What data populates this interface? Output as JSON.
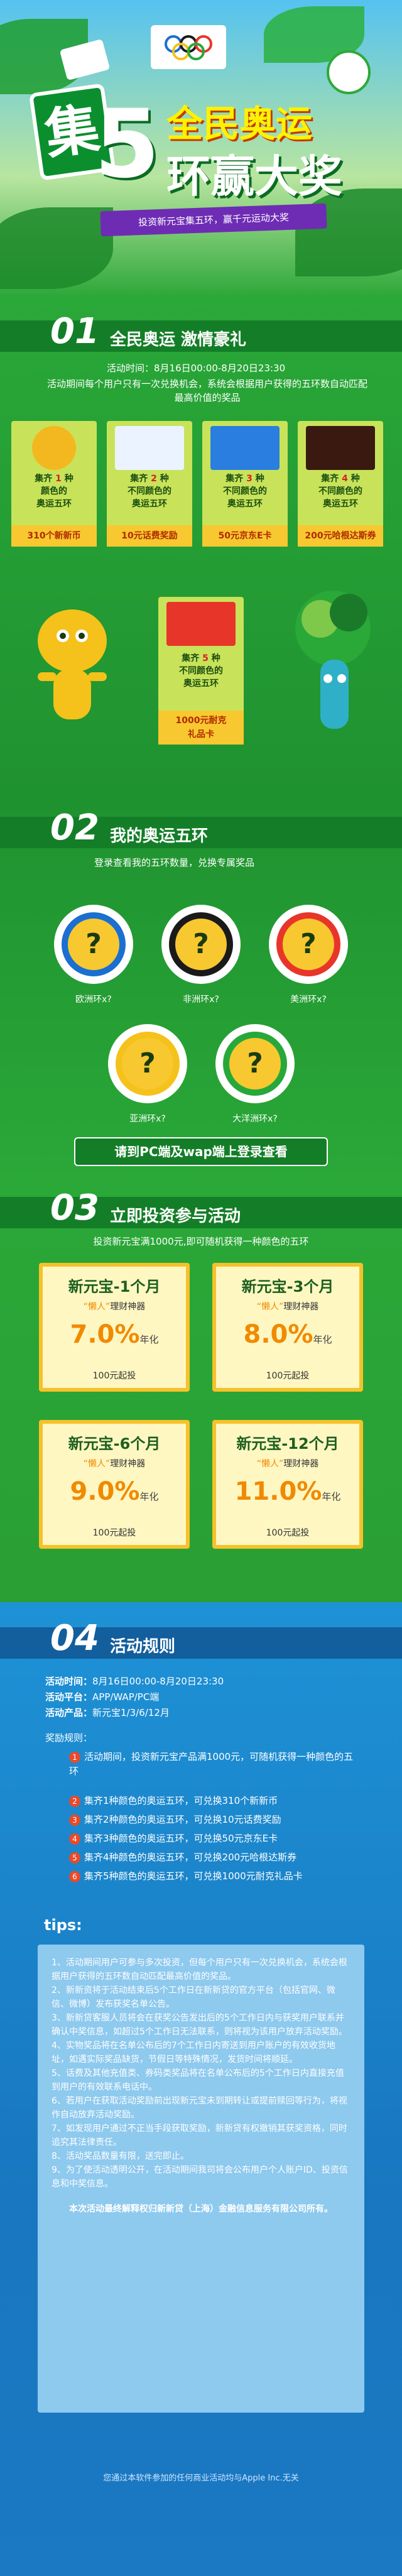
{
  "hero": {
    "ji": "集",
    "five": "5",
    "line1": "全民奥运",
    "line2": "环赢大奖",
    "ribbon": "投资新元宝集五环，赢千元运动大奖"
  },
  "s1": {
    "num": "01",
    "title": "全民奥运 激情豪礼",
    "time": "活动时间：8月16日00:00-8月20日23:30",
    "desc": "活动期间每个用户只有一次兑换机会，系统会根据用户获得的五环数自动匹配最高价值的奖品",
    "prizes": [
      {
        "line1_a": "集齐 ",
        "count": "1",
        "line1_b": " 种",
        "line2": "颜色的",
        "line3": "奥运五环",
        "name": "310个新新币"
      },
      {
        "line1_a": "集齐 ",
        "count": "2",
        "line1_b": " 种",
        "line2": "不同颜色的",
        "line3": "奥运五环",
        "name": "10元话费奖励"
      },
      {
        "line1_a": "集齐 ",
        "count": "3",
        "line1_b": " 种",
        "line2": "不同颜色的",
        "line3": "奥运五环",
        "name": "50元京东E卡"
      },
      {
        "line1_a": "集齐 ",
        "count": "4",
        "line1_b": " 种",
        "line2": "不同颜色的",
        "line3": "奥运五环",
        "name": "200元哈根达斯券"
      }
    ],
    "big_prize": {
      "line1_a": "集齐 ",
      "count": "5",
      "line1_b": " 种",
      "line2": "不同颜色的",
      "line3": "奥运五环",
      "name1": "1000元耐克",
      "name2": "礼品卡"
    },
    "colors": {
      "prize_bg": "#c8e35a",
      "prize_name_bg": "#f8c830"
    }
  },
  "s2": {
    "num": "02",
    "title": "我的奥运五环",
    "desc": "登录查看我的五环数量，兑换专属奖品",
    "rings": [
      {
        "label": "欧洲环x?",
        "q": "?",
        "color": "#1a6fd0"
      },
      {
        "label": "非洲环x?",
        "q": "?",
        "color": "#1a1a1a"
      },
      {
        "label": "美洲环x?",
        "q": "?",
        "color": "#e8352a"
      },
      {
        "label": "亚洲环x?",
        "q": "?",
        "color": "#f4c21a"
      },
      {
        "label": "大洋洲环x?",
        "q": "?",
        "color": "#27a83a"
      }
    ],
    "button": "请到PC端及wap端上登录查看"
  },
  "s3": {
    "num": "03",
    "title": "立即投资参与活动",
    "desc": "投资新元宝满1000元,即可随机获得一种颜色的五环",
    "cards": [
      {
        "title": "新元宝-1个月",
        "sub_q": "“懒人”",
        "sub": "理财神器",
        "rate": "7.0%",
        "unit": "年化",
        "min": "100元起投"
      },
      {
        "title": "新元宝-3个月",
        "sub_q": "“懒人”",
        "sub": "理财神器",
        "rate": "8.0%",
        "unit": "年化",
        "min": "100元起投"
      },
      {
        "title": "新元宝-6个月",
        "sub_q": "“懒人”",
        "sub": "理财神器",
        "rate": "9.0%",
        "unit": "年化",
        "min": "100元起投"
      },
      {
        "title": "新元宝-12个月",
        "sub_q": "“懒人”",
        "sub": "理财神器",
        "rate": "11.0%",
        "unit": "年化",
        "min": "100元起投"
      }
    ]
  },
  "s4": {
    "num": "04",
    "title": "活动规则",
    "time_label": "活动时间：",
    "time": "8月16日00:00-8月20日23:30",
    "platform_label": "活动平台：",
    "platform": "APP/WAP/PC端",
    "product_label": "活动产品：",
    "product": "新元宝1/3/6/12月",
    "reward_label": "奖励规则：",
    "rules": [
      {
        "n": "1",
        "text": "活动期间，投资新元宝产品满1000元，可随机获得一种颜色的五环"
      },
      {
        "n": "2",
        "text": "集齐1种颜色的奥运五环，可兑换310个新新币"
      },
      {
        "n": "3",
        "text": "集齐2种颜色的奥运五环，可兑换10元话费奖励"
      },
      {
        "n": "4",
        "text": "集齐3种颜色的奥运五环，可兑换50元京东E卡"
      },
      {
        "n": "5",
        "text": "集齐4种颜色的奥运五环，可兑换200元哈根达斯券"
      },
      {
        "n": "6",
        "text": "集齐5种颜色的奥运五环，可兑换1000元耐克礼品卡"
      }
    ],
    "tips_title": "tips:",
    "tips": [
      "1、活动期间用户可参与多次投资，但每个用户只有一次兑换机会，系统会根据用户获得的五环数自动匹配最高价值的奖品。",
      "2、新新资将于活动结束后5个工作日在新新贷的官方平台（包括官网、微信、微博）发布获奖名单公告。",
      "3、新新贷客服人员将会在获奖公告发出后的5个工作日内与获奖用户联系并确认中奖信息，如超过5个工作日无法联系，则将视为该用户放弃活动奖励。",
      "4、实物奖品将在名单公布后的7个工作日内寄送到用户账户的有效收货地址，如遇实际奖品缺货，节假日等特殊情况，发货时间将顺延。",
      "5、话费及其他充值类、券码类奖品将在名单公布后的5个工作日内直接充值到用户的有效联系电话中。",
      "6、若用户在获取活动奖励前出现新元宝未到期转让或提前赎回等行为，将视作自动放弃活动奖励。",
      "7、如发现用户通过不正当手段获取奖励，新新贷有权撤销其获奖资格，同时追究其法律责任。",
      "8、活动奖品数量有限，送完即止。",
      "9、为了使活动透明公开，在活动期间我司将会公布用户个人账户ID、投资信息和中奖信息。"
    ],
    "final": "本次活动最终解释权归新新贷（上海）金融信息服务有限公司所有。",
    "apple": "您通过本软件参加的任何商业活动均与Apple Inc.无关"
  }
}
